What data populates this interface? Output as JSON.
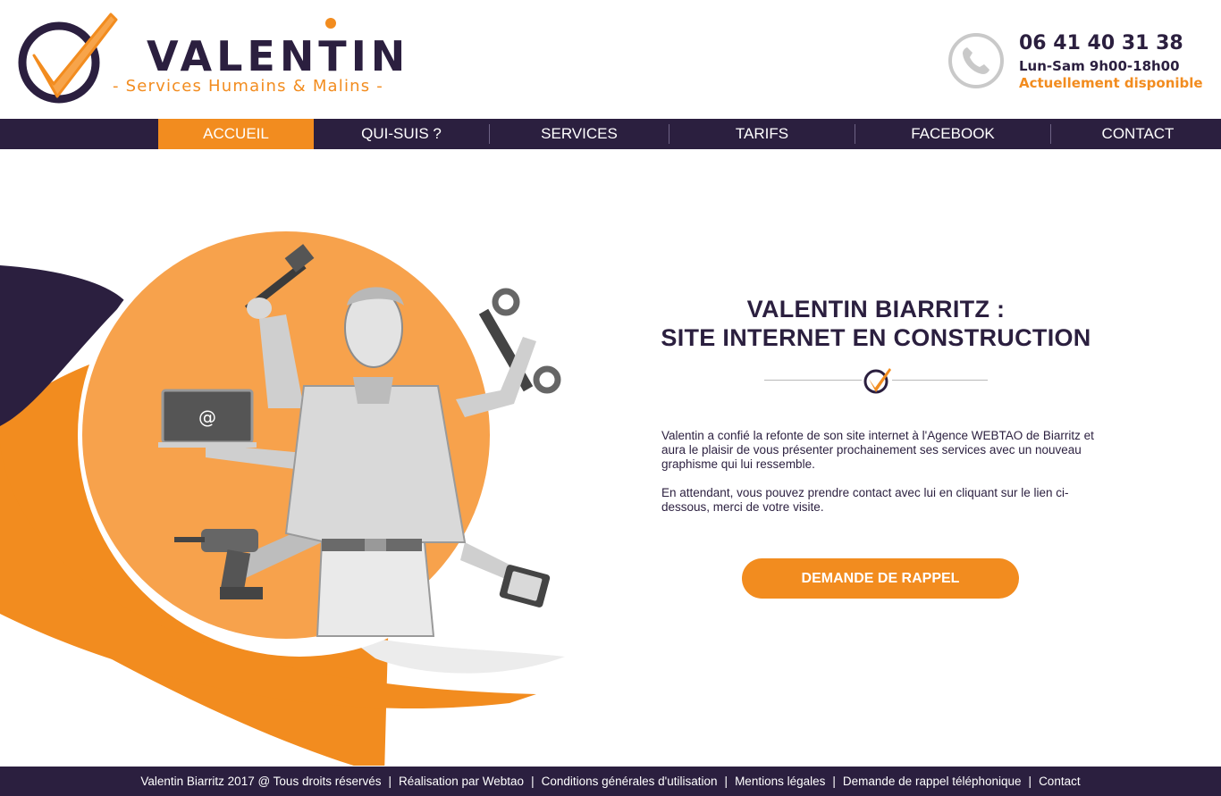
{
  "brand": {
    "name": "VALENTIN",
    "tagline": "- Services Humains & Malins -",
    "colors": {
      "primary": "#2b1f3f",
      "accent": "#f28c1f"
    }
  },
  "contact": {
    "phone": "06 41 40 31 38",
    "hours": "Lun-Sam 9h00-18h00",
    "status": "Actuellement disponible",
    "icon": "phone-icon"
  },
  "nav": {
    "items": [
      {
        "label": "ACCUEIL",
        "active": true
      },
      {
        "label": "QUI-SUIS ?",
        "active": false
      },
      {
        "label": "SERVICES",
        "active": false
      },
      {
        "label": "TARIFS",
        "active": false
      },
      {
        "label": "FACEBOOK",
        "active": false
      },
      {
        "label": "CONTACT",
        "active": false
      }
    ]
  },
  "hero": {
    "title_line1": "VALENTIN BIARRITZ :",
    "title_line2": "SITE INTERNET EN CONSTRUCTION",
    "paragraph1": "Valentin a confié la refonte de son site internet à l'Agence WEBTAO de Biarritz et aura le plaisir de vous présenter prochainement ses services avec un nouveau graphisme qui lui ressemble.",
    "paragraph2": "En attendant, vous pouvez prendre contact avec lui en cliquant sur le lien ci-dessous, merci de votre visite.",
    "cta_label": "DEMANDE DE RAPPEL",
    "illustration_icons": [
      "hammer-icon",
      "wrench-icon",
      "laptop-icon",
      "drill-icon",
      "smartphone-icon"
    ],
    "laptop_symbol": "@"
  },
  "footer": {
    "links": [
      "Valentin Biarritz 2017 @ Tous droits réservés",
      "Réalisation par Webtao",
      "Conditions générales d'utilisation",
      "Mentions légales",
      "Demande de rappel téléphonique",
      "Contact"
    ],
    "separator": "|"
  }
}
